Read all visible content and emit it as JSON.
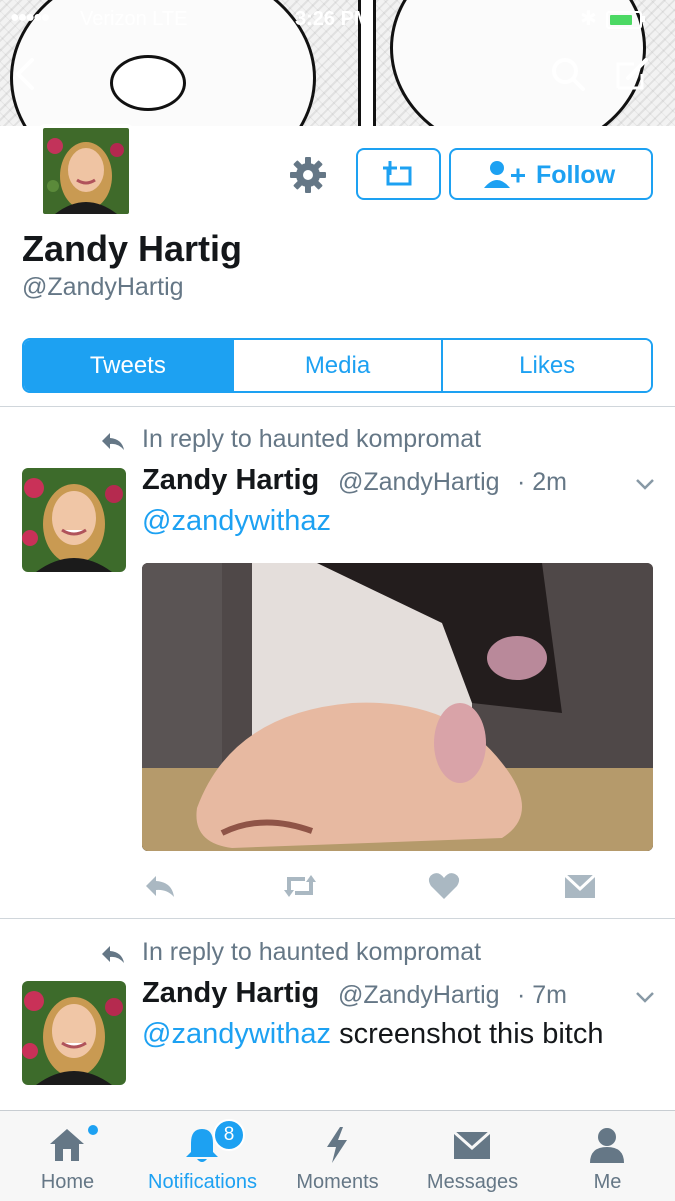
{
  "status_bar": {
    "signal": "●●●●●",
    "carrier": "Verizon  LTE",
    "time": "3:26 PM",
    "battery_level": 0.8
  },
  "profile": {
    "name": "Zandy Hartig",
    "handle": "@ZandyHartig",
    "follow_label": "Follow"
  },
  "tabs": [
    {
      "label": "Tweets",
      "active": true
    },
    {
      "label": "Media",
      "active": false
    },
    {
      "label": "Likes",
      "active": false
    }
  ],
  "tweets": [
    {
      "reply_context": "In reply to haunted kompromat",
      "name": "Zandy Hartig",
      "handle": "@ZandyHartig",
      "time": "· 2m",
      "mention": "@zandywithaz",
      "text": ""
    },
    {
      "reply_context": "In reply to haunted kompromat",
      "name": "Zandy Hartig",
      "handle": "@ZandyHartig",
      "time": "· 7m",
      "mention": "@zandywithaz",
      "text": " screenshot this bitch"
    }
  ],
  "tab_bar": [
    {
      "label": "Home",
      "icon": "home-icon"
    },
    {
      "label": "Notifications",
      "icon": "bell-icon",
      "badge": "8",
      "active": true
    },
    {
      "label": "Moments",
      "icon": "lightning-icon"
    },
    {
      "label": "Messages",
      "icon": "envelope-icon"
    },
    {
      "label": "Me",
      "icon": "person-icon"
    }
  ],
  "colors": {
    "accent": "#1da1f2",
    "muted": "#657786",
    "text": "#14171a"
  }
}
